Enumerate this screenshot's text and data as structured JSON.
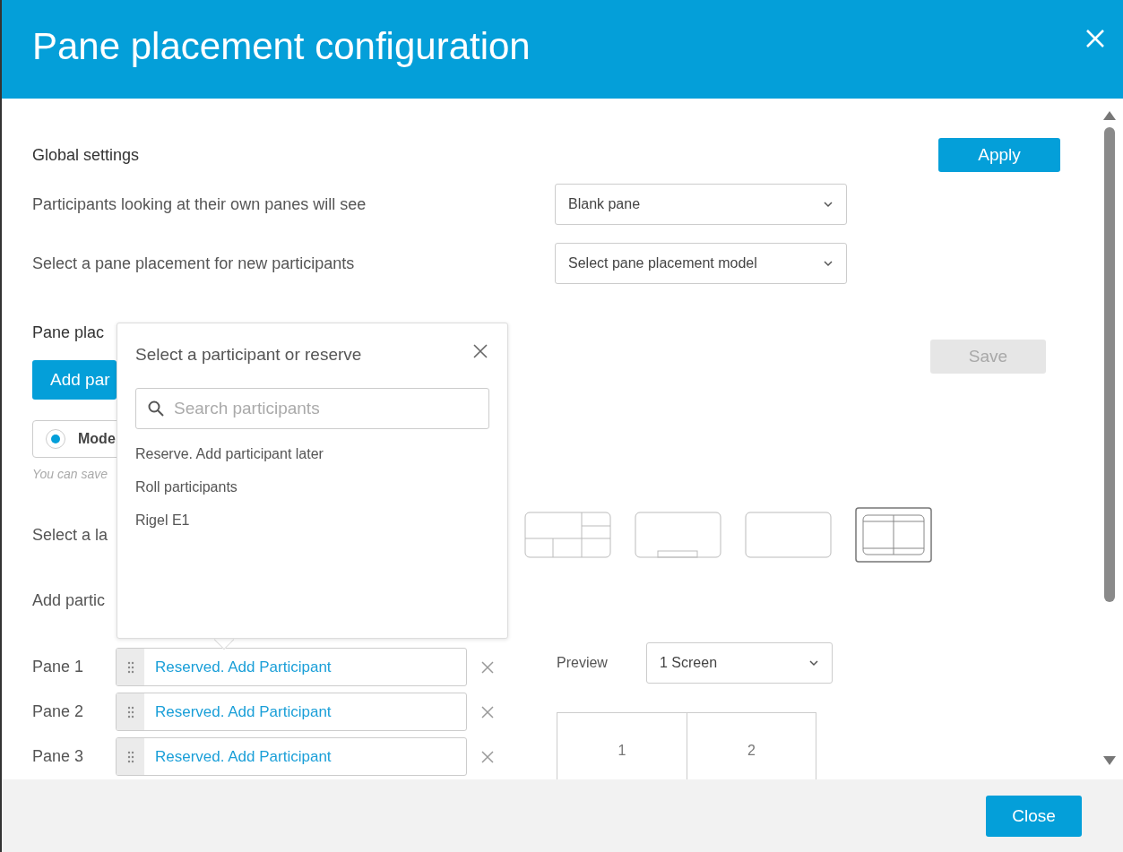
{
  "dialog": {
    "title": "Pane placement configuration"
  },
  "global_settings": {
    "heading": "Global settings",
    "apply_button": "Apply",
    "rows": [
      {
        "label": "Participants looking at their own panes will see",
        "value": "Blank pane"
      },
      {
        "label": "Select a pane placement for new participants",
        "value": "Select pane placement model"
      }
    ]
  },
  "pane_placement": {
    "heading": "Pane plac",
    "add_button": "Add par",
    "save_button": {
      "label": "Save",
      "disabled": true
    },
    "mode_option": {
      "label": "Mode",
      "selected": true
    },
    "hint": "You can save",
    "layout_label": "Select a la",
    "layouts": [
      {
        "kind": "mosaic",
        "selected": false
      },
      {
        "kind": "bottom-strip",
        "selected": false
      },
      {
        "kind": "single",
        "selected": false
      },
      {
        "kind": "quad",
        "selected": true
      }
    ],
    "participants_label": "Add partic",
    "panes": [
      {
        "label": "Pane 1",
        "value": "Reserved. Add Participant"
      },
      {
        "label": "Pane 2",
        "value": "Reserved. Add Participant"
      },
      {
        "label": "Pane 3",
        "value": "Reserved. Add Participant"
      }
    ],
    "preview": {
      "label": "Preview",
      "value": "1 Screen",
      "cells": [
        "1",
        "2"
      ]
    }
  },
  "popover": {
    "title": "Select a participant or reserve",
    "placeholder": "Search participants",
    "items": [
      "Reserve. Add participant later",
      "Roll participants",
      "Rigel E1"
    ]
  },
  "footer": {
    "close_button": "Close"
  }
}
